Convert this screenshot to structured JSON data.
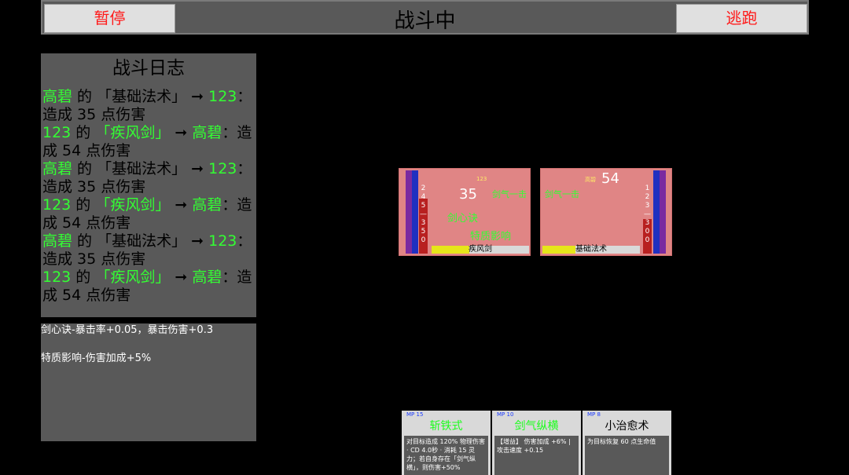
{
  "topbar": {
    "title": "战斗中",
    "pause_label": "暂停",
    "flee_label": "逃跑"
  },
  "log": {
    "title": "战斗日志",
    "entries": [
      {
        "actor": "高碧",
        "mid": " 的 ",
        "skill": "「基础法术」",
        "arrow": " ➞ ",
        "target": "123",
        "result": "：造成 35 点伤害",
        "skill_green": false
      },
      {
        "actor": "123",
        "mid": " 的 ",
        "skill": "「疾风剑」",
        "arrow": " ➞ ",
        "target": "高碧",
        "result": "：造成 54 点伤害",
        "skill_green": true
      },
      {
        "actor": "高碧",
        "mid": " 的 ",
        "skill": "「基础法术」",
        "arrow": " ➞ ",
        "target": "123",
        "result": "：造成 35 点伤害",
        "skill_green": false
      },
      {
        "actor": "123",
        "mid": " 的 ",
        "skill": "「疾风剑」",
        "arrow": " ➞ ",
        "target": "高碧",
        "result": "：造成 54 点伤害",
        "skill_green": true
      },
      {
        "actor": "高碧",
        "mid": " 的 ",
        "skill": "「基础法术」",
        "arrow": " ➞ ",
        "target": "123",
        "result": "：造成 35 点伤害",
        "skill_green": false
      },
      {
        "actor": "123",
        "mid": " 的 ",
        "skill": "「疾风剑」",
        "arrow": " ➞ ",
        "target": "高碧",
        "result": "：造成 54 点伤害",
        "skill_green": true
      }
    ]
  },
  "effects": {
    "line1": "剑心诀-暴击率+0.05，暴击伤害+0.3",
    "line2": "特质影响-伤害加成+5%"
  },
  "cards": {
    "left": {
      "name_small": "123",
      "damage": "35",
      "buff": "剑气一击",
      "trait1": "剑心诀",
      "trait2": "特质影响",
      "hp_digits": [
        "2",
        "4",
        "5",
        "—",
        "3",
        "5",
        "0"
      ],
      "skill_name": "疾风剑",
      "bar_colors": [
        "#7a2aa0",
        "#2030c0"
      ],
      "hp_color": "#b82020"
    },
    "right": {
      "name_small": "高碧",
      "damage": "54",
      "buff": "剑气一击",
      "hp_digits": [
        "1",
        "2",
        "3",
        "—",
        "3",
        "0",
        "0"
      ],
      "skill_name": "基础法术",
      "bar_colors": [
        "#2030c0",
        "#7a2aa0"
      ],
      "hp_color": "#b82020"
    }
  },
  "skills": [
    {
      "mp": "MP 15",
      "name": "斩铁式",
      "desc": "对目标造成 120% 物理伤害 · CD 4.0秒 · 消耗 15 灵力；若自身存在「剑气纵横」，则伤害+50%"
    },
    {
      "mp": "MP 10",
      "name": "剑气纵横",
      "desc": "【增益】 伤害加成 +6% | 攻击速度 +0.15"
    },
    {
      "mp": "MP 8",
      "name": "小治愈术",
      "desc": "为目标恢复 60 点生命值"
    }
  ]
}
